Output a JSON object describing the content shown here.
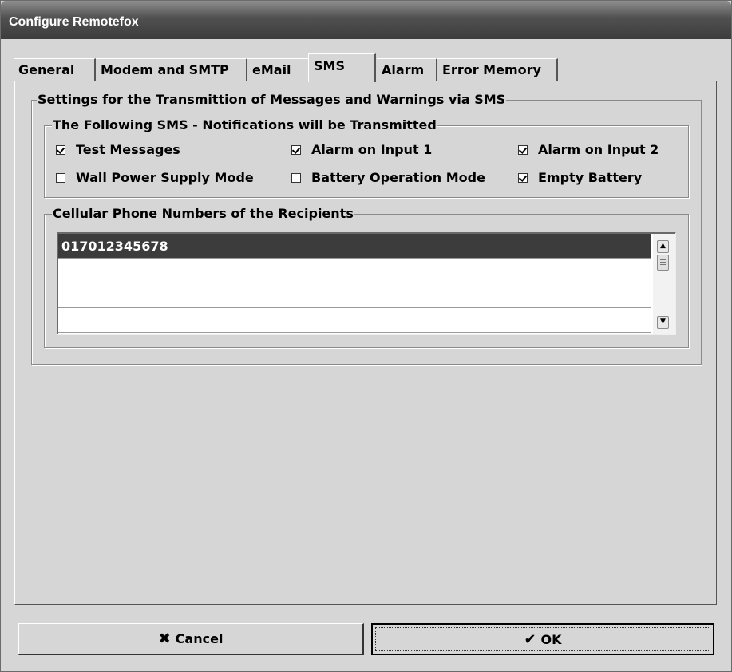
{
  "window": {
    "title": "Configure Remotefox"
  },
  "tabs": [
    {
      "label": "General"
    },
    {
      "label": "Modem and SMTP"
    },
    {
      "label": "eMail"
    },
    {
      "label": "SMS",
      "active": true
    },
    {
      "label": "Alarm"
    },
    {
      "label": "Error Memory"
    }
  ],
  "sms_settings": {
    "group_label": "Settings for the Transmittion of Messages and Warnings via SMS",
    "notifications": {
      "group_label": "The Following SMS - Notifications will be Transmitted",
      "items": [
        {
          "label": "Test Messages",
          "checked": true
        },
        {
          "label": "Alarm on Input 1",
          "checked": true
        },
        {
          "label": "Alarm on Input 2",
          "checked": true
        },
        {
          "label": "Wall Power Supply Mode",
          "checked": false
        },
        {
          "label": "Battery Operation Mode",
          "checked": false
        },
        {
          "label": "Empty Battery",
          "checked": true
        }
      ]
    },
    "recipients": {
      "group_label": "Cellular Phone Numbers of the Recipients",
      "rows": [
        "017012345678",
        "",
        "",
        ""
      ]
    }
  },
  "buttons": {
    "cancel_label": "Cancel",
    "cancel_icon": "x-mark-icon",
    "ok_label": "OK",
    "ok_icon": "checkmark-icon"
  }
}
